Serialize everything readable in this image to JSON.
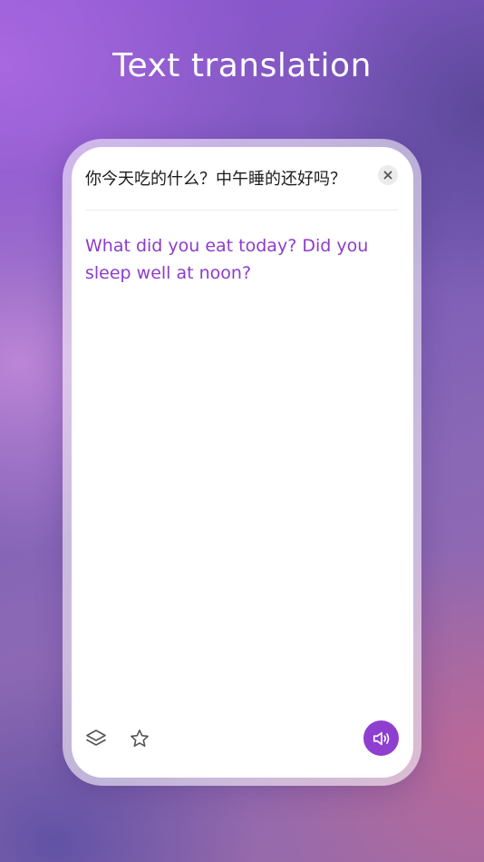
{
  "header": {
    "title": "Text translation"
  },
  "translator": {
    "source_text": "你今天吃的什么？中午睡的还好吗？",
    "translated_text": "What did you eat today? Did you sleep well at noon?"
  },
  "icons": {
    "clear": "close-icon",
    "layers": "layers-icon",
    "favorite": "star-icon",
    "speak": "speaker-icon"
  },
  "colors": {
    "accent": "#8e3fd0",
    "translation_text": "#8d3ccc",
    "source_text": "#1c1c1c",
    "title_text": "#ffffff"
  }
}
